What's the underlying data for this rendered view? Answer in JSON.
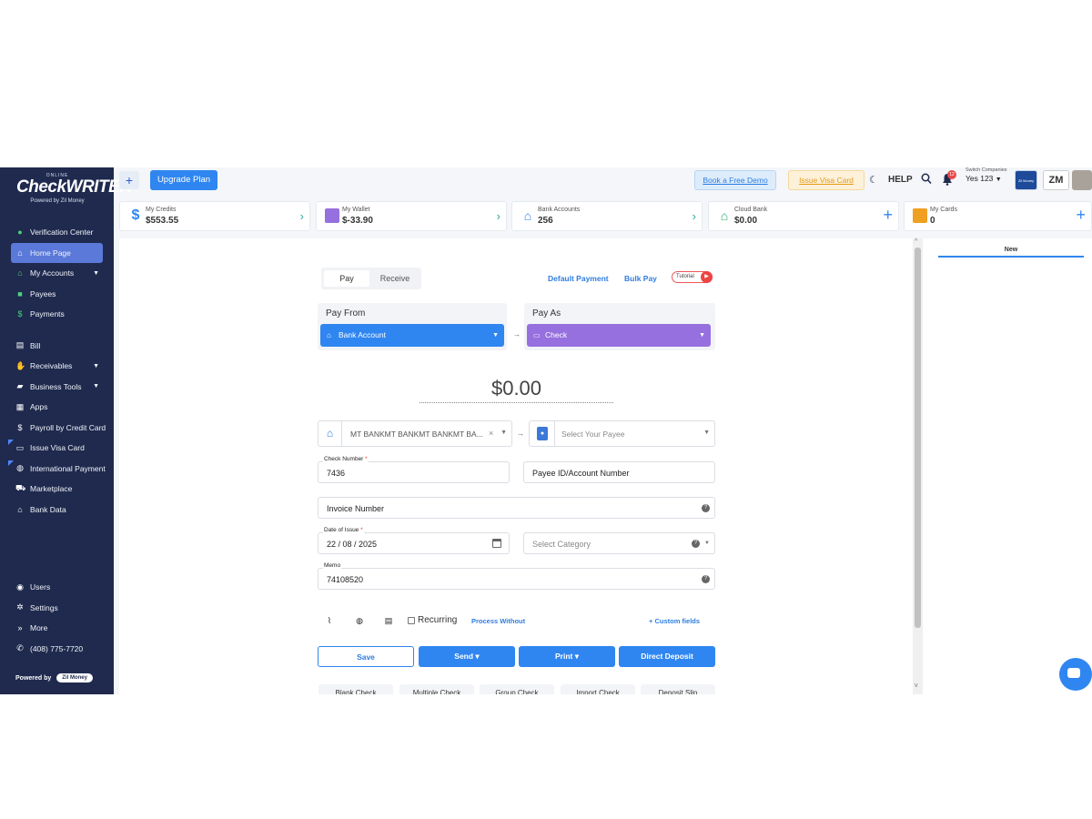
{
  "sidebar": {
    "logo": {
      "online": "ONLINE",
      "brand": "CheckWRITER",
      "powered": "Powered by Zil Money"
    },
    "items": [
      {
        "label": "Verification Center",
        "icon": "check-circle-icon"
      },
      {
        "label": "Home Page",
        "icon": "home-icon",
        "active": true
      },
      {
        "label": "My Accounts",
        "icon": "bank-icon"
      },
      {
        "label": "Payees",
        "icon": "contact-book-icon"
      },
      {
        "label": "Payments",
        "icon": "dollar-icon"
      },
      {
        "label": "Bill",
        "icon": "document-icon"
      },
      {
        "label": "Receivables",
        "icon": "hand-coin-icon"
      },
      {
        "label": "Business Tools",
        "icon": "briefcase-icon"
      },
      {
        "label": "Apps",
        "icon": "grid-icon"
      },
      {
        "label": "Payroll by Credit Card",
        "icon": "dollar-icon"
      },
      {
        "label": "Issue Visa Card",
        "icon": "card-icon"
      },
      {
        "label": "International Payment",
        "icon": "globe-icon"
      },
      {
        "label": "Marketplace",
        "icon": "cart-icon"
      },
      {
        "label": "Bank Data",
        "icon": "bank-icon"
      }
    ],
    "bottom_items": [
      {
        "label": "Users",
        "icon": "users-icon"
      },
      {
        "label": "Settings",
        "icon": "gear-icon"
      },
      {
        "label": "More",
        "icon": "double-chevron-right-icon"
      },
      {
        "label": "(408) 775-7720",
        "icon": "phone-icon"
      }
    ],
    "powered_by": "Powered by",
    "powered_badge": "Zil Money"
  },
  "topbar": {
    "plus": "+",
    "upgrade": "Upgrade Plan",
    "demo": "Book a Free Demo",
    "visa": "Issue Visa Card",
    "help": "HELP",
    "notification_count": "12",
    "switch_label": "Switch Companies",
    "company": "Yes 123",
    "company_logo_text": "Zil Money",
    "initials": "ZM"
  },
  "cards": [
    {
      "label": "My Credits",
      "value": "$553.55",
      "icon": "dollar-icon"
    },
    {
      "label": "My Wallet",
      "value": "$-33.90",
      "icon": "wallet-icon"
    },
    {
      "label": "Bank Accounts",
      "value": "256",
      "icon": "bank-icon"
    },
    {
      "label": "Cloud Bank",
      "value": "$0.00",
      "icon": "bank-icon"
    },
    {
      "label": "My Cards",
      "value": "0",
      "icon": "card-icon"
    }
  ],
  "right_panel": {
    "tab": "New"
  },
  "form": {
    "tab_pay": "Pay",
    "tab_receive": "Receive",
    "default_payment": "Default Payment",
    "bulk_pay": "Bulk Pay",
    "tutorial": "Tutorial",
    "pay_from_title": "Pay From",
    "pay_from_value": "Bank Account",
    "pay_as_title": "Pay As",
    "pay_as_value": "Check",
    "amount": "$0.00",
    "bank_account": "MT BANKMT BANKMT BANKMT BA...",
    "payee_placeholder": "Select Your Payee",
    "check_number_label": "Check Number",
    "check_number": "7436",
    "payee_id_placeholder": "Payee ID/Account Number",
    "invoice_placeholder": "Invoice Number",
    "date_label": "Date of Issue",
    "date_value": "22 / 08 / 2025",
    "category_placeholder": "Select Category",
    "memo_label": "Memo",
    "memo_value": "74108520",
    "recurring": "Recurring",
    "process_without": "Process Without",
    "custom_fields": "+ Custom fields",
    "required_mark": "*"
  },
  "actions": {
    "save": "Save",
    "send": "Send ▾",
    "print": "Print ▾",
    "direct_deposit": "Direct Deposit"
  },
  "bottom_tabs": [
    "Blank Check",
    "Multiple Check",
    "Group Check",
    "Import Check",
    "Deposit Slip"
  ],
  "colors": {
    "sidebar": "#1f2a4e",
    "primary": "#2f86f0",
    "pay_as": "#9670de",
    "wallet_icon": "#9670de",
    "credits_icon": "#2f86f0",
    "cloud_bank_icon": "#2bab6a",
    "cards_icon": "#f0a020"
  }
}
